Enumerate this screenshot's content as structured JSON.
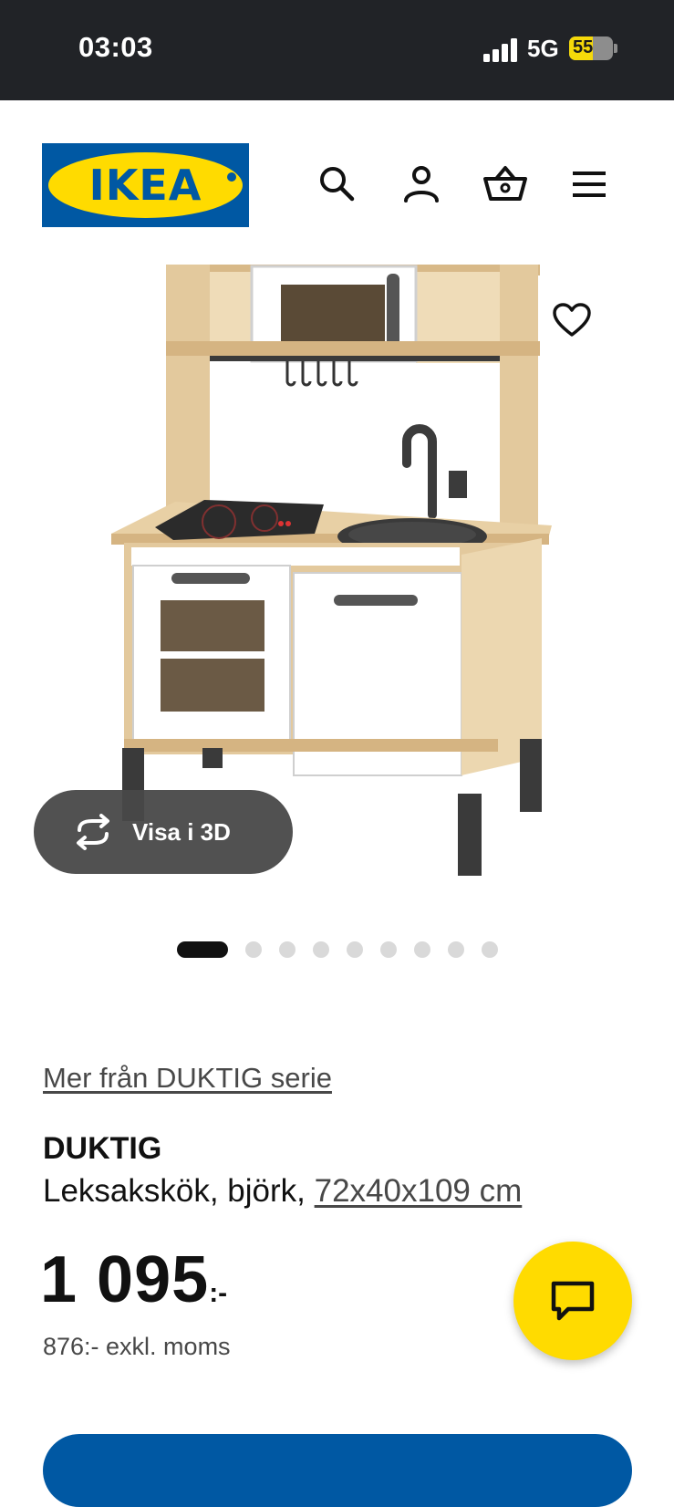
{
  "status_bar": {
    "time": "03:03",
    "network": "5G",
    "battery": "55",
    "battery_level": 0.55
  },
  "header": {
    "logo_text": "IKEA",
    "icons": [
      "search-icon",
      "account-icon",
      "basket-icon",
      "menu-icon"
    ]
  },
  "gallery": {
    "view_3d_label": "Visa i 3D",
    "dot_count": 9,
    "active_dot": 1
  },
  "product": {
    "series_link": "Mer från DUKTIG serie",
    "name": "DUKTIG",
    "description": "Leksakskök, björk, ",
    "size": "72x40x109 cm",
    "price_integer": "1 095",
    "price_suffix": ":-",
    "price_excl_vat": "876:- exkl. moms"
  },
  "colors": {
    "status_bar_bg": "#212327",
    "brand_blue": "#0058a3",
    "brand_yellow": "#ffdb00"
  }
}
